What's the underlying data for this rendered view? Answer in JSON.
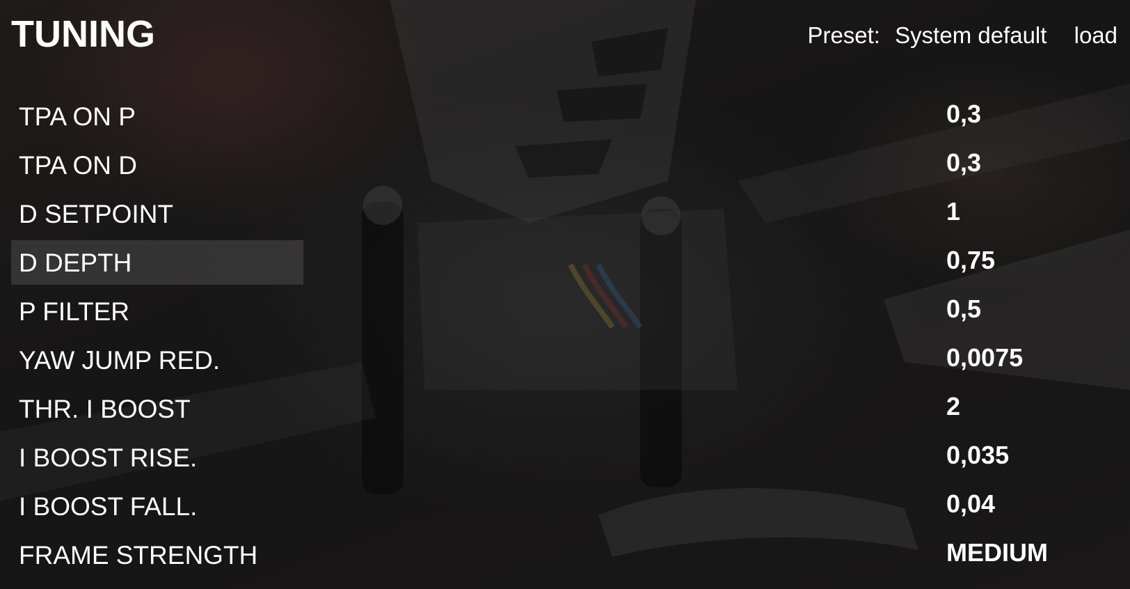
{
  "header": {
    "title": "TUNING",
    "preset_label": "Preset:",
    "preset_value": "System default",
    "load_label": "load"
  },
  "settings": [
    {
      "label": "TPA ON P",
      "value": "0,3",
      "selected": false
    },
    {
      "label": "TPA ON D",
      "value": "0,3",
      "selected": false
    },
    {
      "label": "D SETPOINT",
      "value": "1",
      "selected": false
    },
    {
      "label": "D DEPTH",
      "value": "0,75",
      "selected": true
    },
    {
      "label": "P FILTER",
      "value": "0,5",
      "selected": false
    },
    {
      "label": "YAW JUMP RED.",
      "value": "0,0075",
      "selected": false
    },
    {
      "label": "THR. I BOOST",
      "value": "2",
      "selected": false
    },
    {
      "label": "I BOOST RISE.",
      "value": "0,035",
      "selected": false
    },
    {
      "label": "I BOOST FALL.",
      "value": "0,04",
      "selected": false
    },
    {
      "label": "FRAME STRENGTH",
      "value": "MEDIUM",
      "selected": false
    }
  ],
  "colors": {
    "text": "#ffffff",
    "highlight": "rgba(255,255,255,0.12)",
    "background": "#1c1c1c"
  }
}
